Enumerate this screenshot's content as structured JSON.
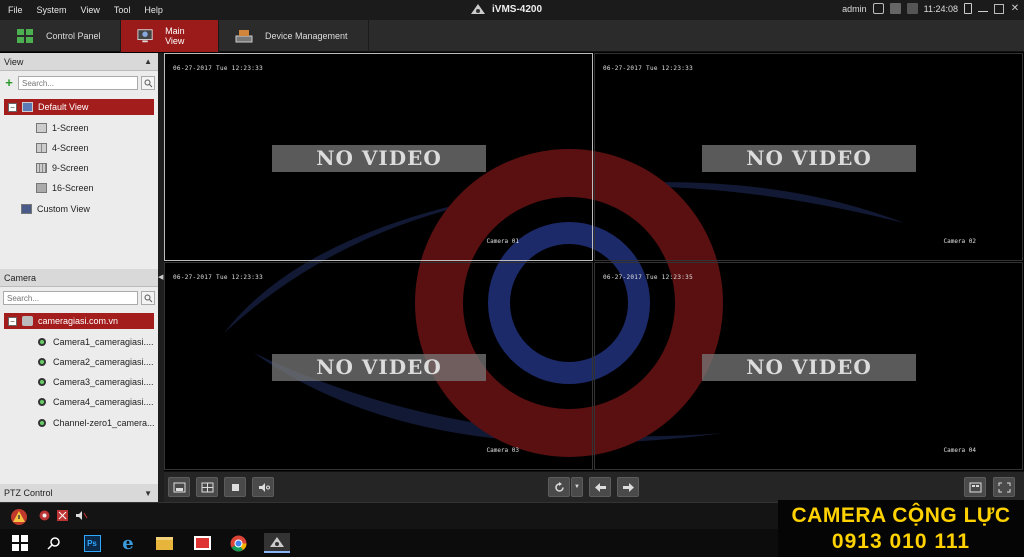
{
  "menu": [
    "File",
    "System",
    "View",
    "Tool",
    "Help"
  ],
  "app": {
    "title": "iVMS-4200",
    "user": "admin",
    "clock": "11:24:08"
  },
  "tabs": [
    {
      "label": "Control Panel",
      "icon": "grid-icon"
    },
    {
      "label": "Main View",
      "icon": "monitor-icon",
      "active": true
    },
    {
      "label": "Device Management",
      "icon": "device-icon"
    }
  ],
  "view_panel": {
    "header": "View",
    "search_placeholder": "Search...",
    "tree": {
      "root": "Default View",
      "items": [
        "1-Screen",
        "4-Screen",
        "9-Screen",
        "16-Screen"
      ],
      "custom": "Custom View"
    }
  },
  "camera_panel": {
    "header": "Camera",
    "search_placeholder": "Search...",
    "group": "cameragiasi.com.vn",
    "cameras": [
      "Camera1_cameragiasi....",
      "Camera2_cameragiasi....",
      "Camera3_cameragiasi....",
      "Camera4_cameragiasi....",
      "Channel-zero1_camera..."
    ]
  },
  "ptz": {
    "header": "PTZ Control"
  },
  "video": {
    "cells": [
      {
        "timestamp": "06-27-2017 Tue 12:23:33",
        "status": "NO VIDEO",
        "label": "Camera 01",
        "active": true
      },
      {
        "timestamp": "06-27-2017 Tue 12:23:33",
        "status": "NO VIDEO",
        "label": "Camera 02",
        "active": false
      },
      {
        "timestamp": "06-27-2017 Tue 12:23:33",
        "status": "NO VIDEO",
        "label": "Camera 03",
        "active": false
      },
      {
        "timestamp": "06-27-2017 Tue 12:23:35",
        "status": "NO VIDEO",
        "label": "Camera 04",
        "active": false
      }
    ]
  },
  "promo": {
    "line1": "CAMERA CỘNG LỰC",
    "line2": "0913 010 111"
  },
  "colors": {
    "accent": "#9b1b1b",
    "promo_text": "#ffd200",
    "watermark_red": "#8a1a1a",
    "watermark_blue": "#1c2a6a"
  }
}
